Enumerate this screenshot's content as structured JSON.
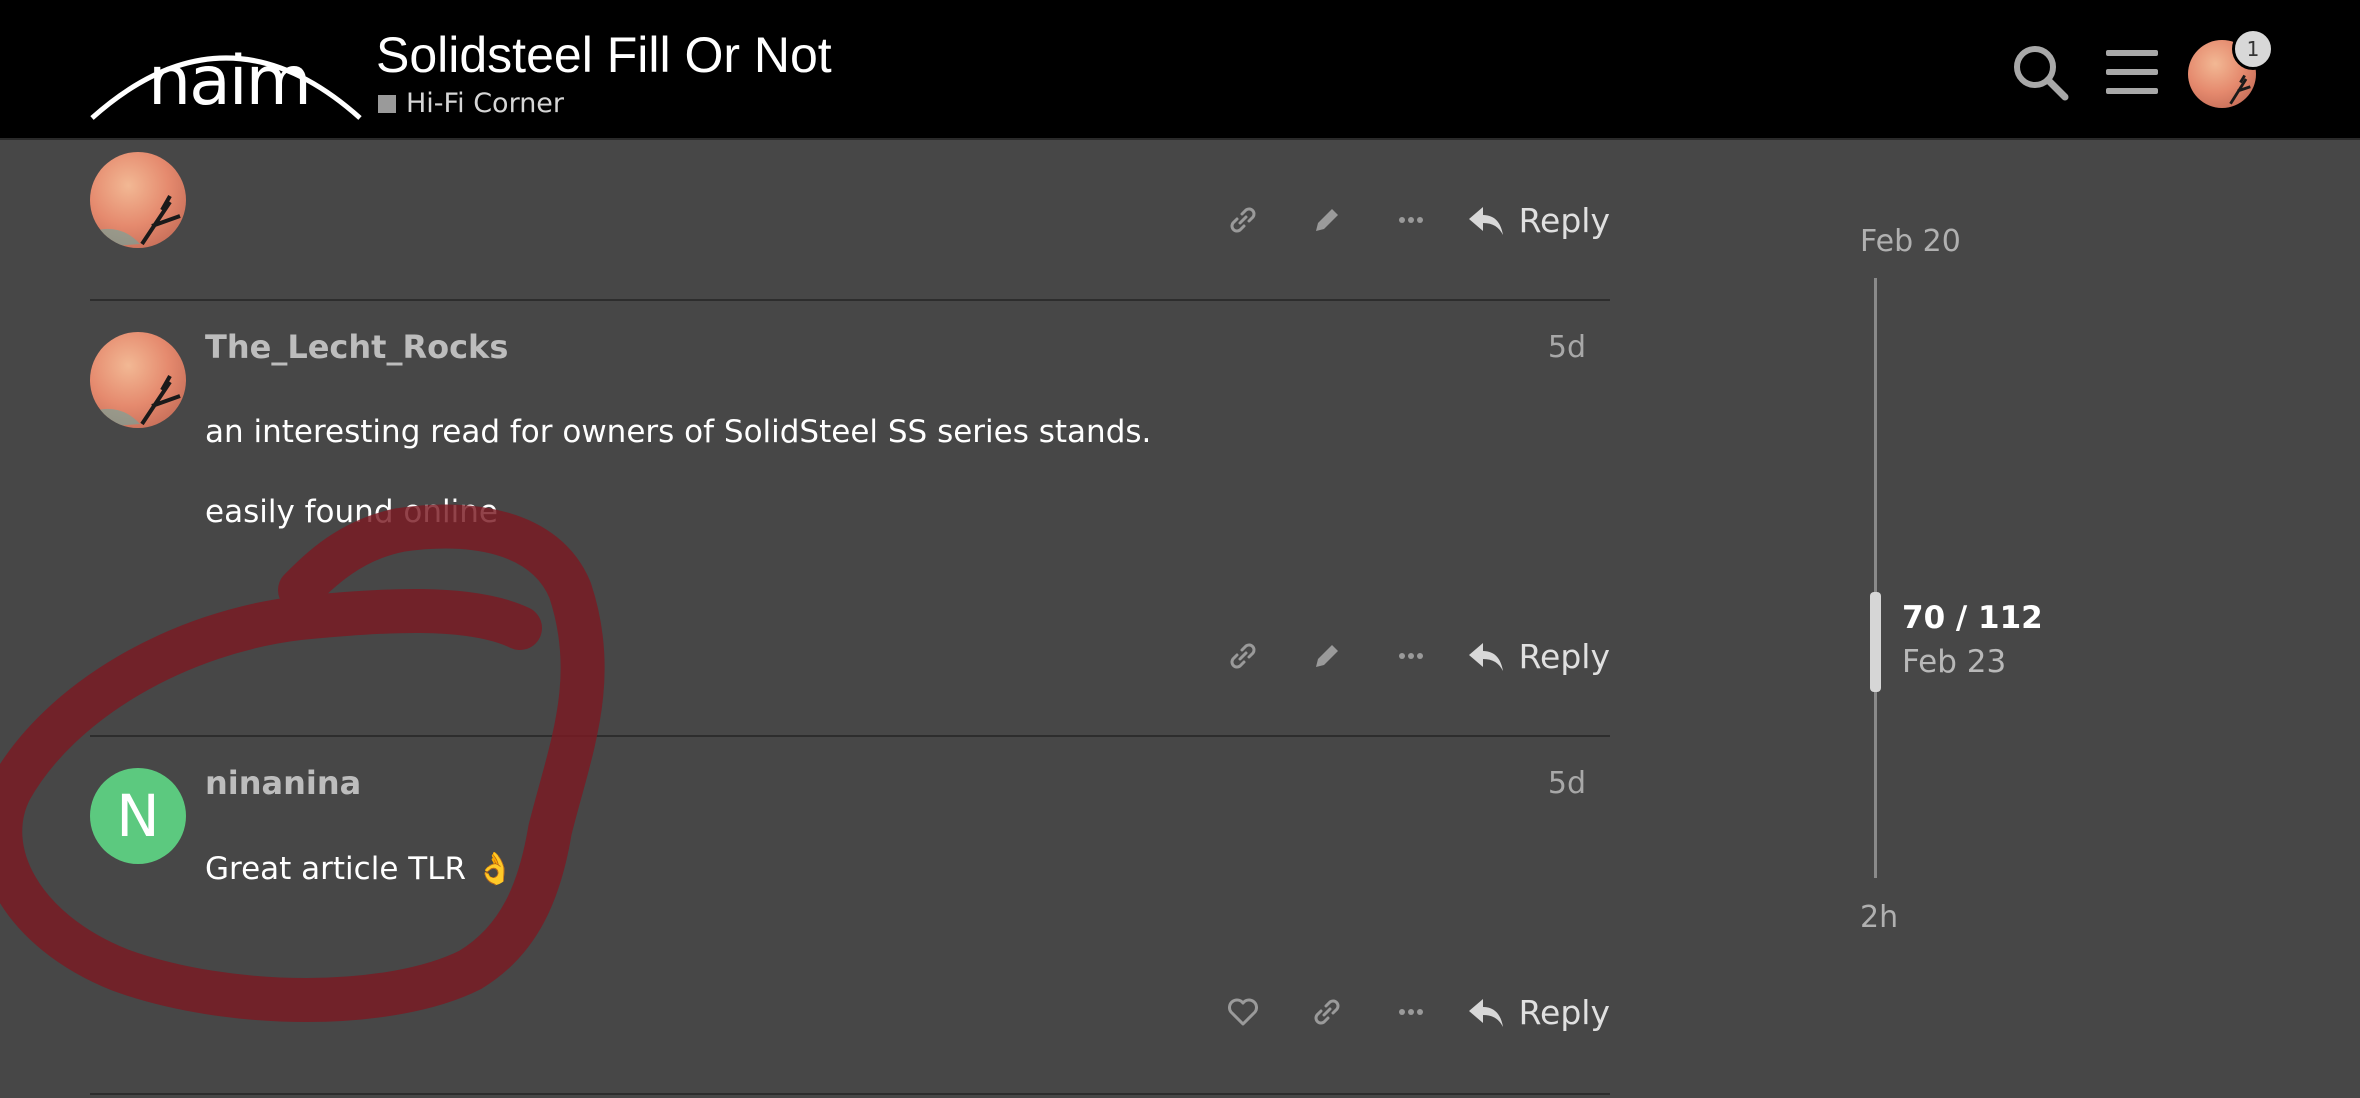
{
  "header": {
    "logo_text": "naim",
    "topic_title": "Solidsteel Fill Or Not",
    "category": "Hi-Fi Corner",
    "notification_count": "1",
    "icons": {
      "search": "search-icon",
      "menu": "hamburger-menu-icon",
      "avatar": "user-avatar"
    }
  },
  "posts": [
    {
      "username": "",
      "date": "",
      "body": [],
      "actions": {
        "reply_label": "Reply",
        "icons": [
          "link-icon",
          "pencil-icon",
          "ellipsis-icon",
          "reply-icon"
        ]
      }
    },
    {
      "username": "The_Lecht_Rocks",
      "date": "5d",
      "body": [
        "an interesting read for owners of SolidSteel SS series stands.",
        "easily found online"
      ],
      "actions": {
        "reply_label": "Reply",
        "icons": [
          "link-icon",
          "pencil-icon",
          "ellipsis-icon",
          "reply-icon"
        ]
      }
    },
    {
      "username": "ninanina",
      "avatar_letter": "N",
      "date": "5d",
      "body": [
        "Great article TLR 👌"
      ],
      "actions": {
        "reply_label": "Reply",
        "icons": [
          "heart-icon",
          "link-icon",
          "ellipsis-icon",
          "reply-icon"
        ]
      }
    }
  ],
  "timeline": {
    "start_date": "Feb 20",
    "position": "70 / 112",
    "position_date": "Feb 23",
    "end_label": "2h"
  },
  "colors": {
    "header_bg": "#000000",
    "page_bg": "#474747",
    "letter_avatar": "#5cc97f",
    "annotation": "#7a1a22"
  }
}
